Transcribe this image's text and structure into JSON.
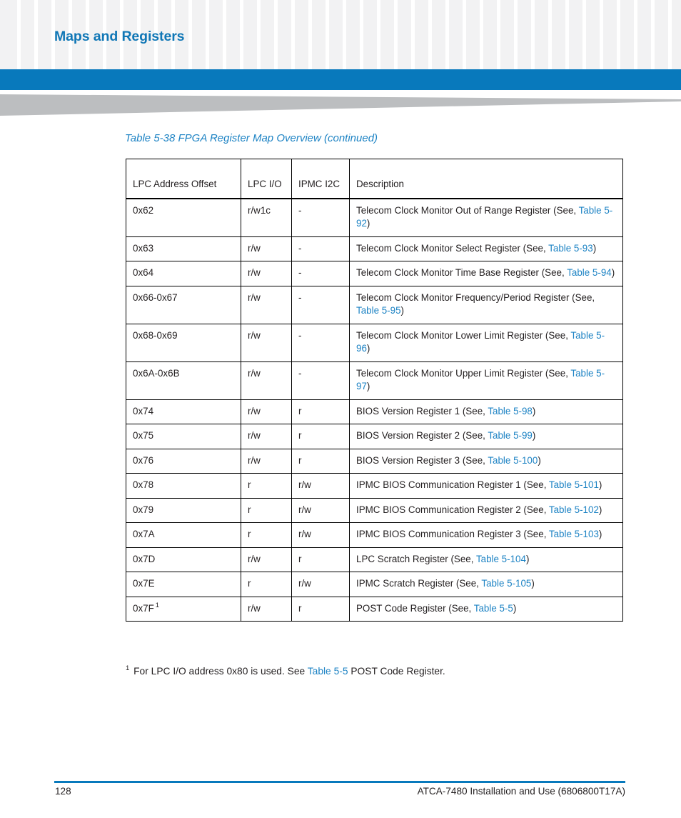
{
  "header": {
    "chapter_title": "Maps and Registers",
    "accent_color": "#0879bc",
    "pattern_square_color": "#f2f2f3",
    "wedge_color": "#bcbec0"
  },
  "table": {
    "caption": "Table 5-38 FPGA Register Map Overview  (continued)",
    "columns": [
      "LPC Address Offset",
      "LPC I/O",
      "IPMC I2C",
      "Description"
    ],
    "rows": [
      {
        "offset": "0x62",
        "offset_footnote": "",
        "lpc_io": "r/w1c",
        "ipmc_i2c": "-",
        "desc_pre": "Telecom Clock Monitor Out of Range Register (See, ",
        "desc_link": "Table 5-92",
        "desc_post": ")"
      },
      {
        "offset": "0x63",
        "offset_footnote": "",
        "lpc_io": "r/w",
        "ipmc_i2c": "-",
        "desc_pre": "Telecom Clock Monitor Select Register (See, ",
        "desc_link": "Table 5-93",
        "desc_post": ")"
      },
      {
        "offset": "0x64",
        "offset_footnote": "",
        "lpc_io": "r/w",
        "ipmc_i2c": "-",
        "desc_pre": "Telecom Clock Monitor Time Base Register (See, ",
        "desc_link": "Table 5-94",
        "desc_post": ")"
      },
      {
        "offset": "0x66-0x67",
        "offset_footnote": "",
        "lpc_io": "r/w",
        "ipmc_i2c": "-",
        "desc_pre": "Telecom Clock Monitor Frequency/Period Register (See, ",
        "desc_link": "Table 5-95",
        "desc_post": ")"
      },
      {
        "offset": "0x68-0x69",
        "offset_footnote": "",
        "lpc_io": "r/w",
        "ipmc_i2c": "-",
        "desc_pre": "Telecom Clock Monitor Lower Limit Register (See, ",
        "desc_link": "Table 5-96",
        "desc_post": ")"
      },
      {
        "offset": "0x6A-0x6B",
        "offset_footnote": "",
        "lpc_io": "r/w",
        "ipmc_i2c": "-",
        "desc_pre": "Telecom Clock Monitor Upper Limit Register (See, ",
        "desc_link": "Table 5-97",
        "desc_post": ")"
      },
      {
        "offset": "0x74",
        "offset_footnote": "",
        "lpc_io": "r/w",
        "ipmc_i2c": "r",
        "desc_pre": "BIOS Version Register 1 (See, ",
        "desc_link": "Table 5-98",
        "desc_post": ")"
      },
      {
        "offset": "0x75",
        "offset_footnote": "",
        "lpc_io": "r/w",
        "ipmc_i2c": "r",
        "desc_pre": "BIOS Version Register 2 (See, ",
        "desc_link": "Table 5-99",
        "desc_post": ")"
      },
      {
        "offset": "0x76",
        "offset_footnote": "",
        "lpc_io": "r/w",
        "ipmc_i2c": "r",
        "desc_pre": "BIOS Version Register 3 (See, ",
        "desc_link": "Table 5-100",
        "desc_post": ")"
      },
      {
        "offset": "0x78",
        "offset_footnote": "",
        "lpc_io": "r",
        "ipmc_i2c": "r/w",
        "desc_pre": "IPMC BIOS Communication Register 1 (See, ",
        "desc_link": "Table 5-101",
        "desc_post": ")"
      },
      {
        "offset": "0x79",
        "offset_footnote": "",
        "lpc_io": "r",
        "ipmc_i2c": "r/w",
        "desc_pre": "IPMC BIOS Communication Register 2 (See, ",
        "desc_link": "Table 5-102",
        "desc_post": ")"
      },
      {
        "offset": "0x7A",
        "offset_footnote": "",
        "lpc_io": "r",
        "ipmc_i2c": "r/w",
        "desc_pre": "IPMC BIOS Communication Register 3 (See, ",
        "desc_link": "Table 5-103",
        "desc_post": ")"
      },
      {
        "offset": "0x7D",
        "offset_footnote": "",
        "lpc_io": "r/w",
        "ipmc_i2c": "r",
        "desc_pre": "LPC Scratch Register (See, ",
        "desc_link": "Table 5-104",
        "desc_post": ")"
      },
      {
        "offset": "0x7E",
        "offset_footnote": "",
        "lpc_io": "r",
        "ipmc_i2c": "r/w",
        "desc_pre": "IPMC Scratch Register (See, ",
        "desc_link": "Table 5-105",
        "desc_post": ")"
      },
      {
        "offset": "0x7F",
        "offset_footnote": "1",
        "lpc_io": "r/w",
        "ipmc_i2c": "r",
        "desc_pre": "POST Code Register (See, ",
        "desc_link": "Table 5-5",
        "desc_post": ")"
      }
    ]
  },
  "footnote": {
    "marker": "1",
    "text_pre": " For LPC I/O address 0x80 is used. See ",
    "link": "Table 5-5",
    "text_post": " POST Code Register."
  },
  "footer": {
    "page_number": "128",
    "document_title": "ATCA-7480 Installation and Use (6806800T17A)"
  }
}
